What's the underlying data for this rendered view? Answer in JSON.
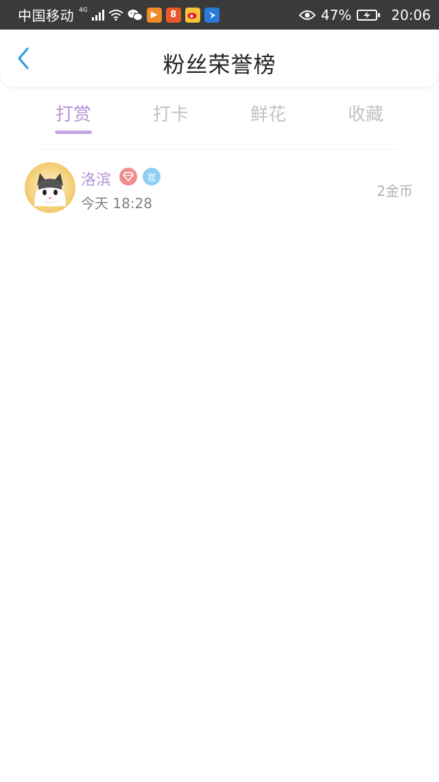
{
  "status_bar": {
    "carrier": "中国移动",
    "network": "4G",
    "battery": "47%",
    "time": "20:06",
    "icons": [
      "signal-icon",
      "wifi-icon",
      "wechat-icon",
      "video-app-icon",
      "app-icon",
      "weibo-icon",
      "bird-app-icon",
      "eye-icon",
      "battery-icon"
    ]
  },
  "header": {
    "title": "粉丝荣誉榜",
    "back_icon": "chevron-left-icon"
  },
  "tabs": [
    {
      "label": "打赏",
      "active": true
    },
    {
      "label": "打卡",
      "active": false
    },
    {
      "label": "鲜花",
      "active": false
    },
    {
      "label": "收藏",
      "active": false
    }
  ],
  "list": [
    {
      "name": "洛滨",
      "time": "今天 18:28",
      "amount": "2金币",
      "badges": [
        "diamond-badge-icon",
        "official-badge-icon"
      ],
      "official_badge_text": "官"
    }
  ],
  "colors": {
    "accent": "#b794d9",
    "back_arrow": "#2e9ce6",
    "status_bar_bg": "#3a3a3a",
    "inactive_tab": "#c2c2c2"
  }
}
